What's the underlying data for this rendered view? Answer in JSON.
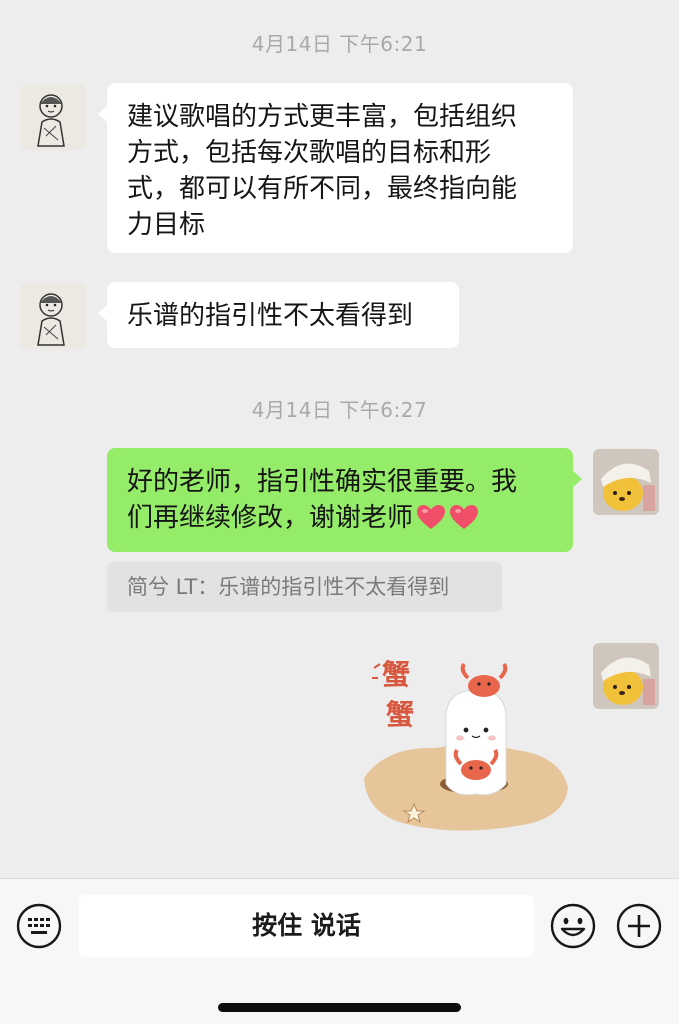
{
  "messages": {
    "time1": "4月14日 下午6:21",
    "msg1": "建议歌唱的方式更丰富，包括组织方式，包括每次歌唱的目标和形式，都可以有所不同，最终指向能力目标",
    "msg1_lines": [
      "建议歌唱的方式更丰富，包括组织",
      "方式，包括每次歌唱的目标和形",
      "式，都可以有所不同，最终指向能",
      "力目标"
    ],
    "msg2": "乐谱的指引性不太看得到",
    "time2": "4月14日 下午6:27",
    "msg3_lines": [
      "好的老师，指引性确实很重要。我",
      "们再继续修改，谢谢老师"
    ],
    "quote": "简兮 LT：乐谱的指引性不太看得到",
    "sticker_text": "蟹蟹",
    "sticker_icon": "crab-sticker"
  },
  "input_bar": {
    "talk_label": "按住 说话",
    "keyboard_icon": "keyboard-icon",
    "emoji_icon": "smiley-icon",
    "plus_icon": "plus-icon"
  },
  "colors": {
    "background": "#ededed",
    "bubble_green": "#95ec69",
    "bubble_white": "#ffffff",
    "heart": "#f04f6a"
  }
}
